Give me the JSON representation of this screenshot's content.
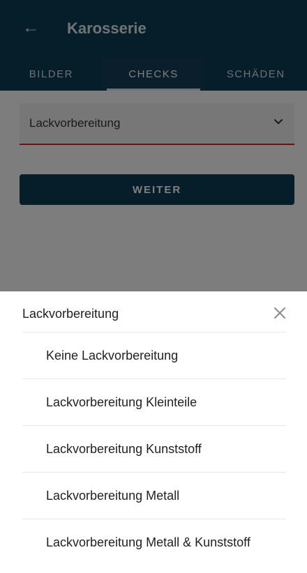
{
  "appbar": {
    "back_icon": "arrow-left-icon",
    "title": "Karosserie"
  },
  "tabs": [
    {
      "label": "BILDER",
      "active": false
    },
    {
      "label": "CHECKS",
      "active": true
    },
    {
      "label": "SCHÄDEN",
      "active": false
    }
  ],
  "form": {
    "dropdown_value": "Lackvorbereitung",
    "dropdown_icon": "chevron-down-icon",
    "submit_label": "WEITER"
  },
  "sheet": {
    "title": "Lackvorbereitung",
    "close_icon": "close-icon",
    "options": [
      "Keine Lackvorbereitung",
      "Lackvorbereitung Kleinteile",
      "Lackvorbereitung Kunststoff",
      "Lackvorbereitung Metall",
      "Lackvorbereitung Metall & Kunststoff"
    ]
  },
  "colors": {
    "primary": "#0d3a54",
    "accent_error": "#c22b33"
  }
}
